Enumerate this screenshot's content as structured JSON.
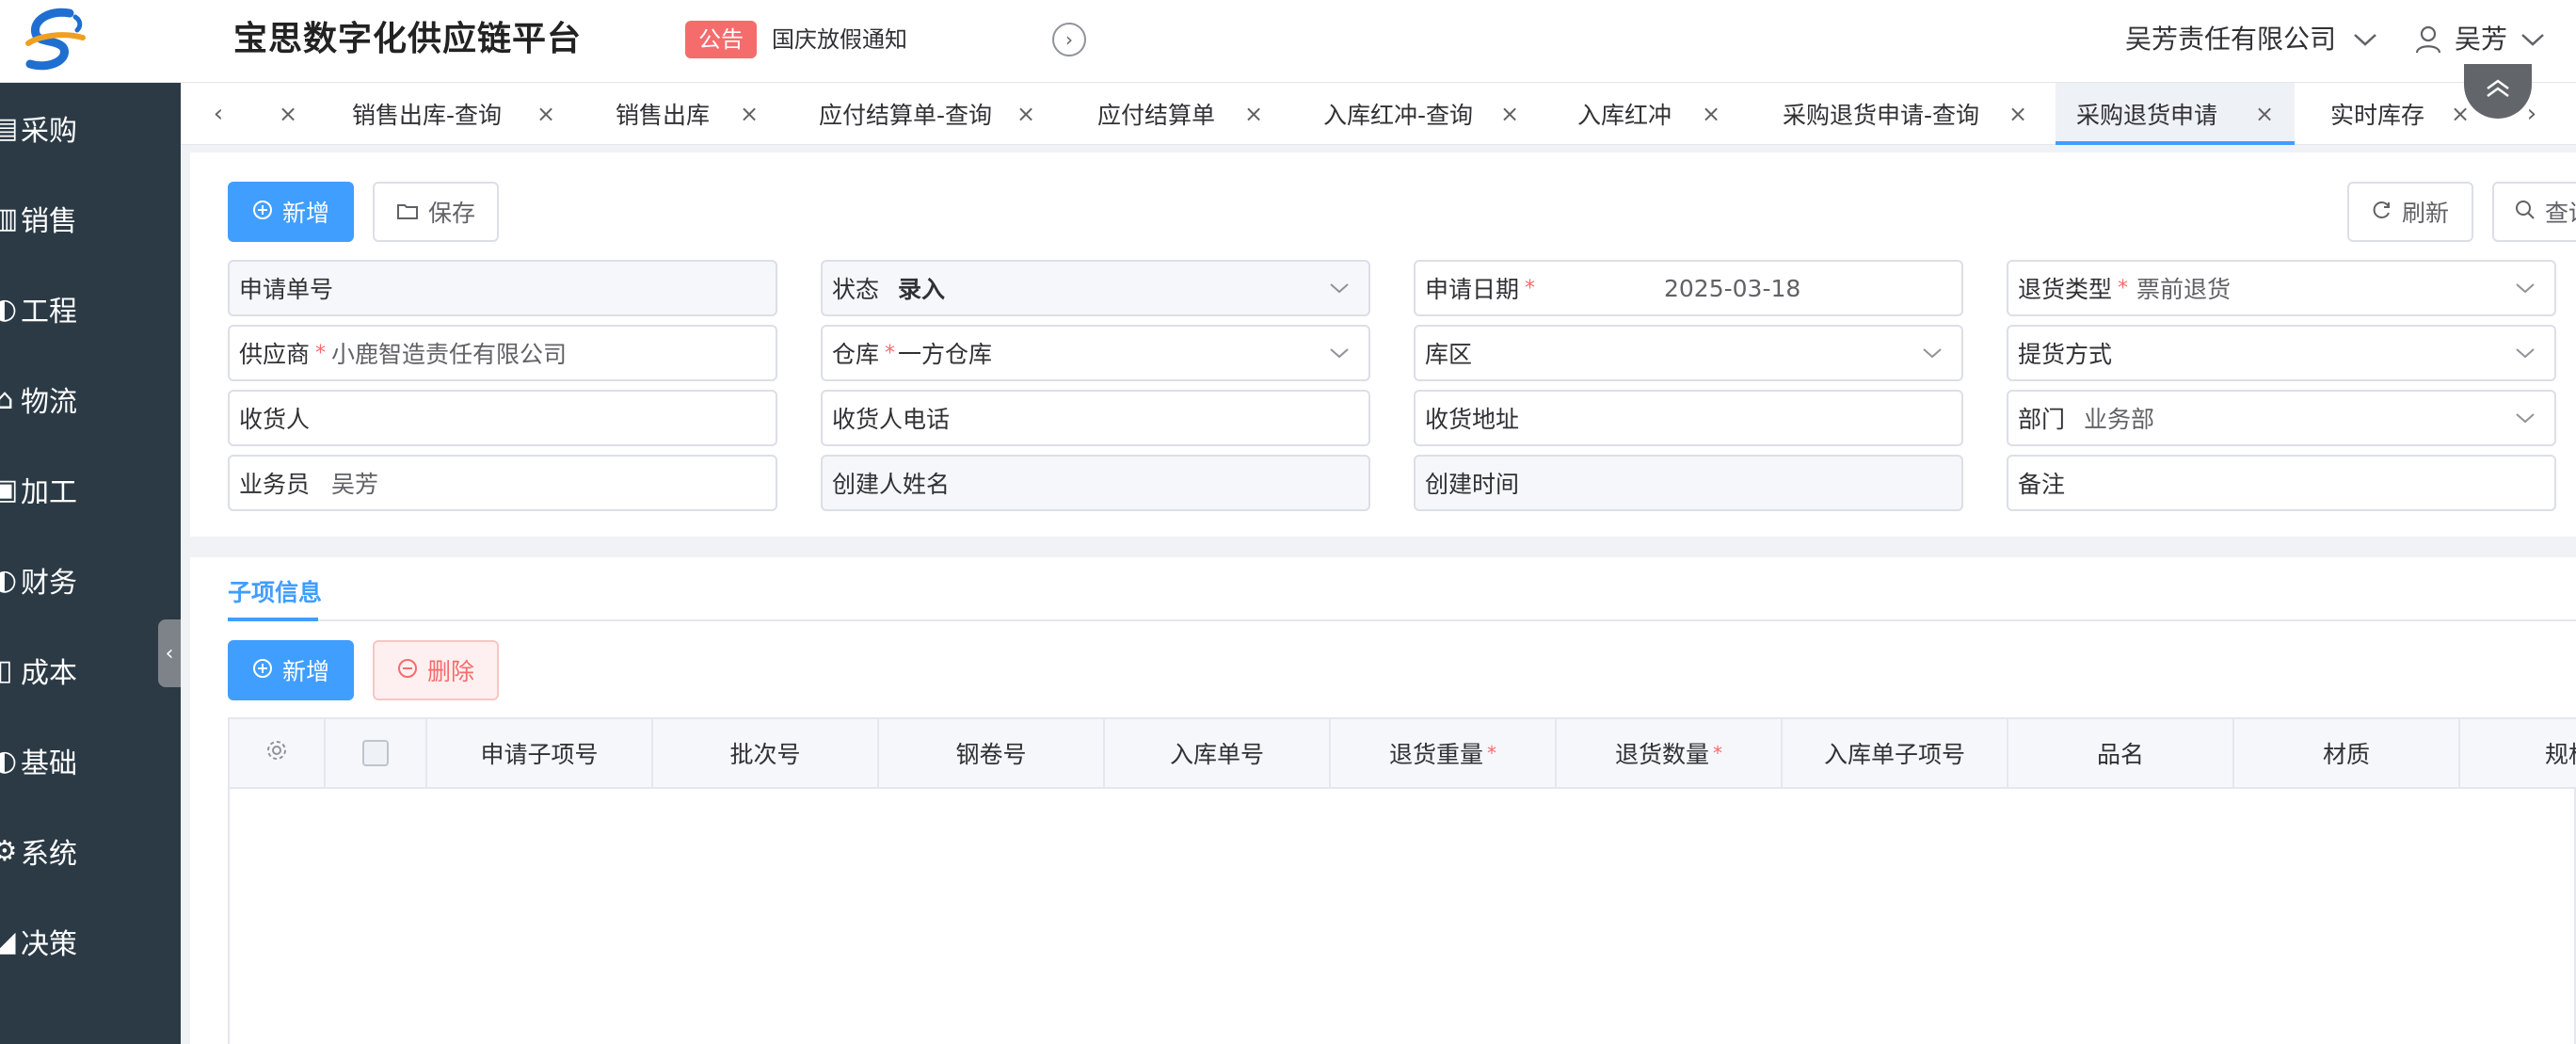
{
  "header": {
    "app_title": "宝思数字化供应链平台",
    "notice_badge": "公告",
    "notice_text": "国庆放假通知",
    "company": "吴芳责任有限公司",
    "user": "吴芳"
  },
  "sidebar": {
    "items": [
      {
        "label": "采购",
        "icon": "cart-icon"
      },
      {
        "label": "销售",
        "icon": "chart-icon"
      },
      {
        "label": "工程",
        "icon": "circle-icon"
      },
      {
        "label": "物流",
        "icon": "home-icon"
      },
      {
        "label": "加工",
        "icon": "box-icon"
      },
      {
        "label": "财务",
        "icon": "circle-icon"
      },
      {
        "label": "成本",
        "icon": "doc-icon"
      },
      {
        "label": "基础",
        "icon": "circle-icon"
      },
      {
        "label": "系统",
        "icon": "gear-icon"
      },
      {
        "label": "决策",
        "icon": "graph-icon"
      }
    ]
  },
  "tabs": [
    {
      "label": "销售出库-查询"
    },
    {
      "label": "销售出库"
    },
    {
      "label": "应付结算单-查询"
    },
    {
      "label": "应付结算单"
    },
    {
      "label": "入库红冲-查询"
    },
    {
      "label": "入库红冲"
    },
    {
      "label": "采购退货申请-查询"
    },
    {
      "label": "采购退货申请",
      "active": true
    },
    {
      "label": "实时库存"
    }
  ],
  "toolbar": {
    "add_label": "新增",
    "save_label": "保存",
    "refresh_label": "刷新",
    "query_label": "查询"
  },
  "form": {
    "apply_no": {
      "label": "申请单号",
      "value": ""
    },
    "status": {
      "label": "状态",
      "value": "录入"
    },
    "apply_date": {
      "label": "申请日期",
      "value": "2025-03-18"
    },
    "return_type": {
      "label": "退货类型",
      "value": "票前退货"
    },
    "supplier": {
      "label": "供应商",
      "value": "小鹿智造责任有限公司"
    },
    "warehouse": {
      "label": "仓库",
      "value": "一方仓库"
    },
    "zone": {
      "label": "库区",
      "value": ""
    },
    "pickup": {
      "label": "提货方式",
      "value": ""
    },
    "receiver": {
      "label": "收货人",
      "value": ""
    },
    "receiver_phone": {
      "label": "收货人电话",
      "value": ""
    },
    "receiver_addr": {
      "label": "收货地址",
      "value": ""
    },
    "dept": {
      "label": "部门",
      "value": "业务部"
    },
    "salesman": {
      "label": "业务员",
      "value": "吴芳"
    },
    "creator": {
      "label": "创建人姓名",
      "value": ""
    },
    "create_time": {
      "label": "创建时间",
      "value": ""
    },
    "remark": {
      "label": "备注",
      "value": ""
    }
  },
  "detail": {
    "tab_label": "子项信息",
    "add_label": "新增",
    "delete_label": "删除",
    "columns": [
      {
        "label": "申请子项号",
        "required": false
      },
      {
        "label": "批次号",
        "required": false
      },
      {
        "label": "钢卷号",
        "required": false
      },
      {
        "label": "入库单号",
        "required": false
      },
      {
        "label": "退货重量",
        "required": true
      },
      {
        "label": "退货数量",
        "required": true
      },
      {
        "label": "入库单子项号",
        "required": false
      },
      {
        "label": "品名",
        "required": false
      },
      {
        "label": "材质",
        "required": false
      },
      {
        "label": "规格",
        "required": false
      }
    ]
  },
  "colors": {
    "primary": "#409eff",
    "danger": "#f56c6c",
    "sidebar_bg": "#2b3a45"
  }
}
